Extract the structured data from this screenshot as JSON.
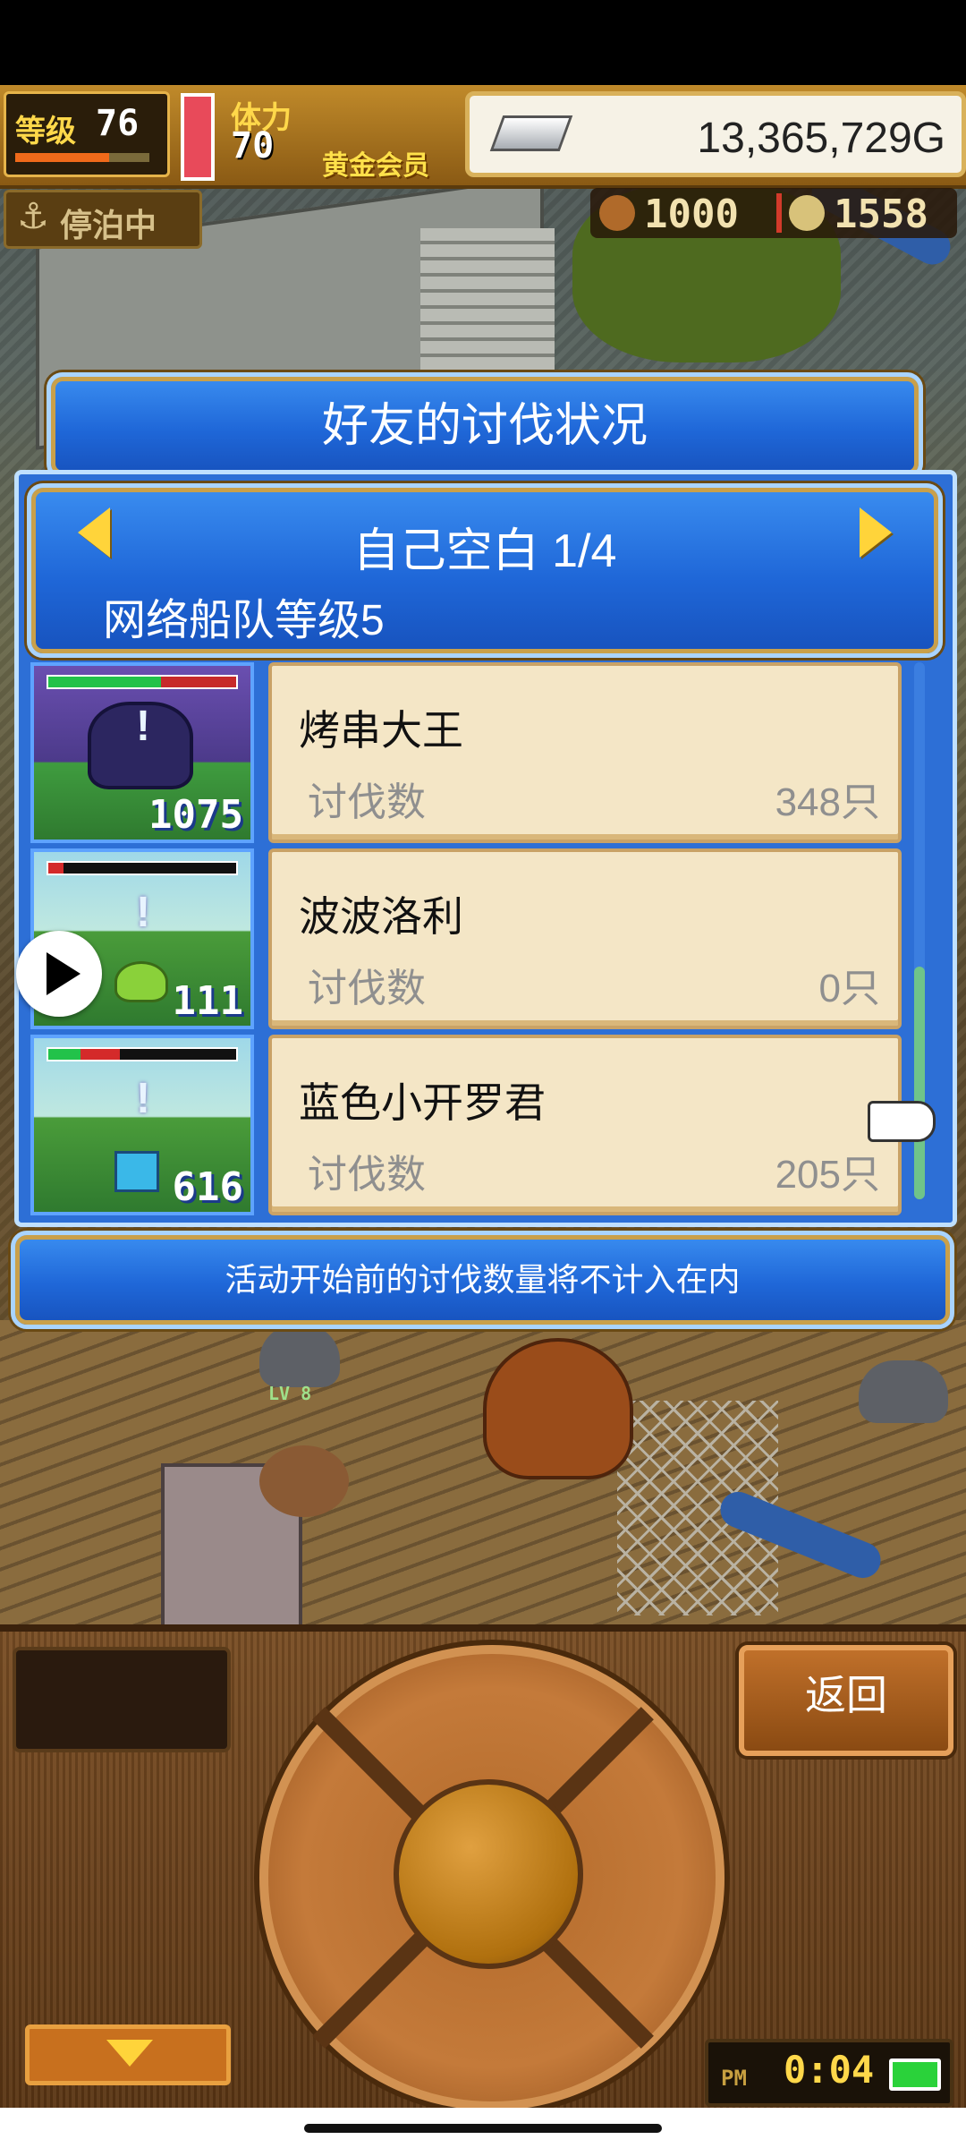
{
  "hud": {
    "level_label": "等级",
    "level_value": "76",
    "stamina_label": "体力",
    "stamina_value": "70",
    "membership": "黄金会员",
    "gold": "13,365,729G",
    "dock_status": "停泊中",
    "resource_1": "1000",
    "resource_2": "1558"
  },
  "dialog": {
    "title": "好友的讨伐状况",
    "page_label": "自己空白 1/4",
    "fleet_level": "网络船队等级5",
    "footer_note": "活动开始前的讨伐数量将不计入在内"
  },
  "list": [
    {
      "name": "烤串大王",
      "label": "讨伐数",
      "count": "348只",
      "monster_level": "1075",
      "hp_fill": 0.6
    },
    {
      "name": "波波洛利",
      "label": "讨伐数",
      "count": "0只",
      "monster_level": "111",
      "hp_fill": 0.08
    },
    {
      "name": "蓝色小开罗君",
      "label": "讨伐数",
      "count": "205只",
      "monster_level": "616",
      "hp_fill": 0.38
    }
  ],
  "controls": {
    "back_button": "返回",
    "clock_ampm": "PM",
    "clock_time": "0:04"
  },
  "world": {
    "lv_tag": "LV 8"
  },
  "colors": {
    "dialog_blue": "#1f67d8",
    "card_bg": "#f4e6c6",
    "gold_trim": "#e6b44a"
  }
}
